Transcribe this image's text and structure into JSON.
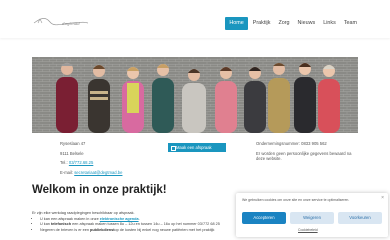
{
  "header": {
    "logo_text": "dagtmad",
    "nav": [
      {
        "label": "Home",
        "active": true
      },
      {
        "label": "Praktijk",
        "active": false
      },
      {
        "label": "Zorg",
        "active": false
      },
      {
        "label": "Nieuws",
        "active": false
      },
      {
        "label": "Links",
        "active": false
      },
      {
        "label": "Team",
        "active": false
      }
    ]
  },
  "contact": {
    "street": "Ryseslaan 47",
    "city": "9111 Belsele",
    "tel_label": "Tel.:",
    "tel": "03/772.68.25",
    "email_label": "E-mail:",
    "email": "secretariaat@degtmad.be",
    "cta": "Maak een afspraak",
    "company_number": "Ondernemingsnummer: 0833 905 562",
    "privacy": "Er worden geen persoonlijke gegevens bewaard na deze website."
  },
  "welcome": {
    "title": "Welkom in onze praktijk!",
    "intro": "Er zijn elke werkdag raadplegingen beschikbaar op afspraak.",
    "bullets": [
      {
        "prefix": "U kan een afspraak maken in onze ",
        "link": "elektronische agenda",
        "suffix": "."
      },
      {
        "prefix": "U kan ",
        "link": "telefonisch",
        "suffix": " een afspraak maken tussen 8u – 12u en tussen 14u – 16u op het nummer 03/772 68 25"
      },
      {
        "prefix": "Negeren de brieven is er een ",
        "link": "publiekdienst",
        "suffix": "op de kosten bij enkel nog neuwe patiënten met het praktijk"
      }
    ]
  },
  "cookie": {
    "text": "We gebruiken cookies om onze site en onze service te optimaliseren.",
    "close": "×",
    "accept": "Accepteren",
    "refuse": "Weigeren",
    "prefs": "Voorkeuren",
    "policy": "Cookiebeleid"
  },
  "colors": {
    "accent": "#1a96bf",
    "cookie_btn": "#1a83c2"
  }
}
